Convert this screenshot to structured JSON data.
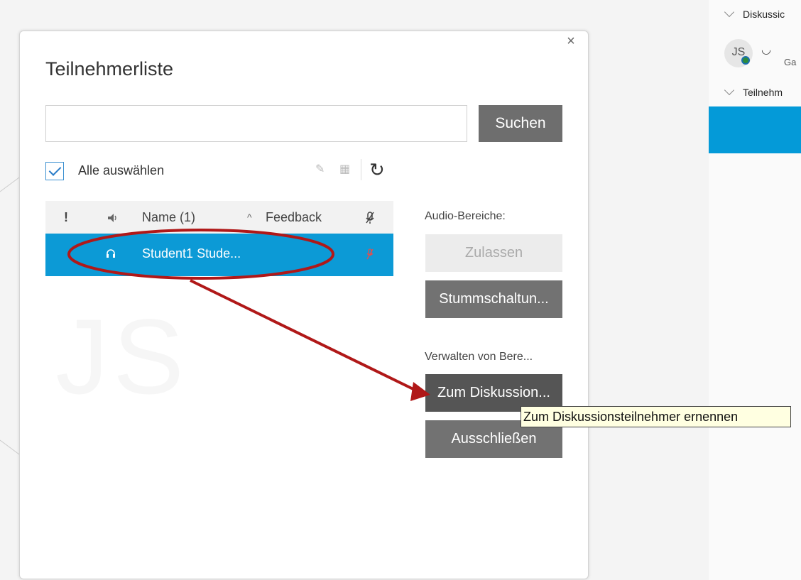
{
  "right_panel": {
    "section1": "Diskussic",
    "avatar_initials": "JS",
    "sub_text": "Ga",
    "section2": "Teilnehm"
  },
  "dialog": {
    "title": "Teilnehmerliste",
    "search": {
      "value": "",
      "placeholder": "",
      "button": "Suchen"
    },
    "select_all": {
      "label": "Alle auswählen",
      "checked": true
    },
    "table": {
      "headers": [
        "!",
        "Name (1)",
        "Feedback"
      ],
      "sort_indicator": "^",
      "rows": [
        {
          "name": "Student1 Stude...",
          "selected": true
        }
      ]
    },
    "audio": {
      "label": "Audio-Bereiche:",
      "allow_button": "Zulassen",
      "mute_button": "Stummschaltun..."
    },
    "manage": {
      "label": "Verwalten von Bere...",
      "promote_button": "Zum Diskussion...",
      "exclude_button": "Ausschließen"
    },
    "tooltip": "Zum Diskussionsteilnehmer ernennen",
    "background_initials": "JS"
  },
  "colors": {
    "selection_blue": "#0c9ad6",
    "annotation_red": "#b01818",
    "button_grey": "#727272"
  }
}
